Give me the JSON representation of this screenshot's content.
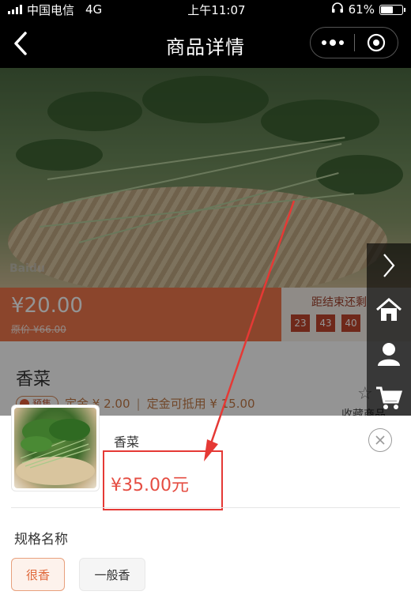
{
  "status_bar": {
    "carrier": "中国电信",
    "network": "4G",
    "time": "上午11:07",
    "battery": "61%",
    "battery_level": 0.61
  },
  "nav": {
    "title": "商品详情",
    "back_icon": "chevron-left-icon",
    "more_icon": "more-dots-icon",
    "close_icon": "target-circle-icon"
  },
  "background_page": {
    "watermark": "Baidu",
    "price": "¥20.00",
    "original_price": "原价 ¥66.00",
    "countdown_label": "距结束还剩",
    "countdown": [
      "23",
      "43",
      "40"
    ],
    "product_name": "香菜",
    "presale_badge": "预售",
    "deposit": "定金 ¥ 2.00",
    "deposit_deduct": "定金可抵用 ¥ 15.00",
    "favorite": "收藏商品"
  },
  "side_tools": [
    "chevron-right-icon",
    "home-icon",
    "user-icon",
    "cart-icon"
  ],
  "sheet": {
    "product_name": "香菜",
    "price": "¥35.00元",
    "spec_title": "规格名称",
    "options": [
      {
        "label": "很香",
        "selected": true
      },
      {
        "label": "一般香",
        "selected": false
      }
    ],
    "close_icon": "close-circle-icon"
  },
  "colors": {
    "accent": "#e06a3d",
    "price": "#e54d42",
    "highlight": "#e53935"
  }
}
